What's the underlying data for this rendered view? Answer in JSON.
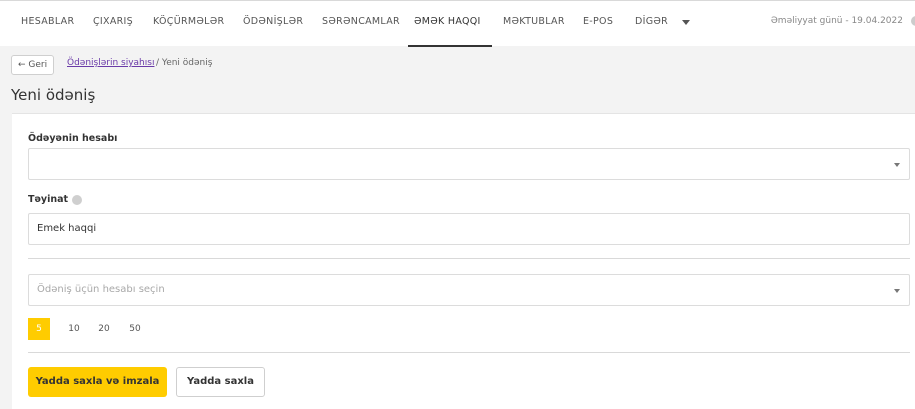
{
  "nav": {
    "items": [
      {
        "label": "HESABLAR"
      },
      {
        "label": "ÇIXARIŞ"
      },
      {
        "label": "KÖÇÜRMƏLƏR"
      },
      {
        "label": "ÖDƏNİŞLƏR"
      },
      {
        "label": "SƏRƏNCAMLAR"
      },
      {
        "label": "ƏMƏK HAQQI"
      },
      {
        "label": "MƏKTUBLAR"
      },
      {
        "label": "E-POS"
      },
      {
        "label": "DİGƏR"
      }
    ],
    "operational_day": "Əməliyyat günü - 19.04.2022"
  },
  "breadcrumb": {
    "back_label": "← Geri",
    "link": "Ödənişlərin siyahısı",
    "current": "/ Yeni ödəniş"
  },
  "page": {
    "title": "Yeni ödəniş"
  },
  "form": {
    "payer_account_label": "Ödəyənin hesabı",
    "payer_account_value": "",
    "purpose_label": "Təyinat",
    "purpose_value": "Emek haqqi",
    "payment_account_placeholder": "Ödəniş üçün hesabı seçin",
    "page_sizes": [
      "5",
      "10",
      "20",
      "50"
    ],
    "page_size_selected": "5",
    "save_sign_label": "Yadda saxla və imzala",
    "save_label": "Yadda saxla"
  },
  "colors": {
    "accent": "#ffcc00",
    "link": "#6a3aa8"
  }
}
